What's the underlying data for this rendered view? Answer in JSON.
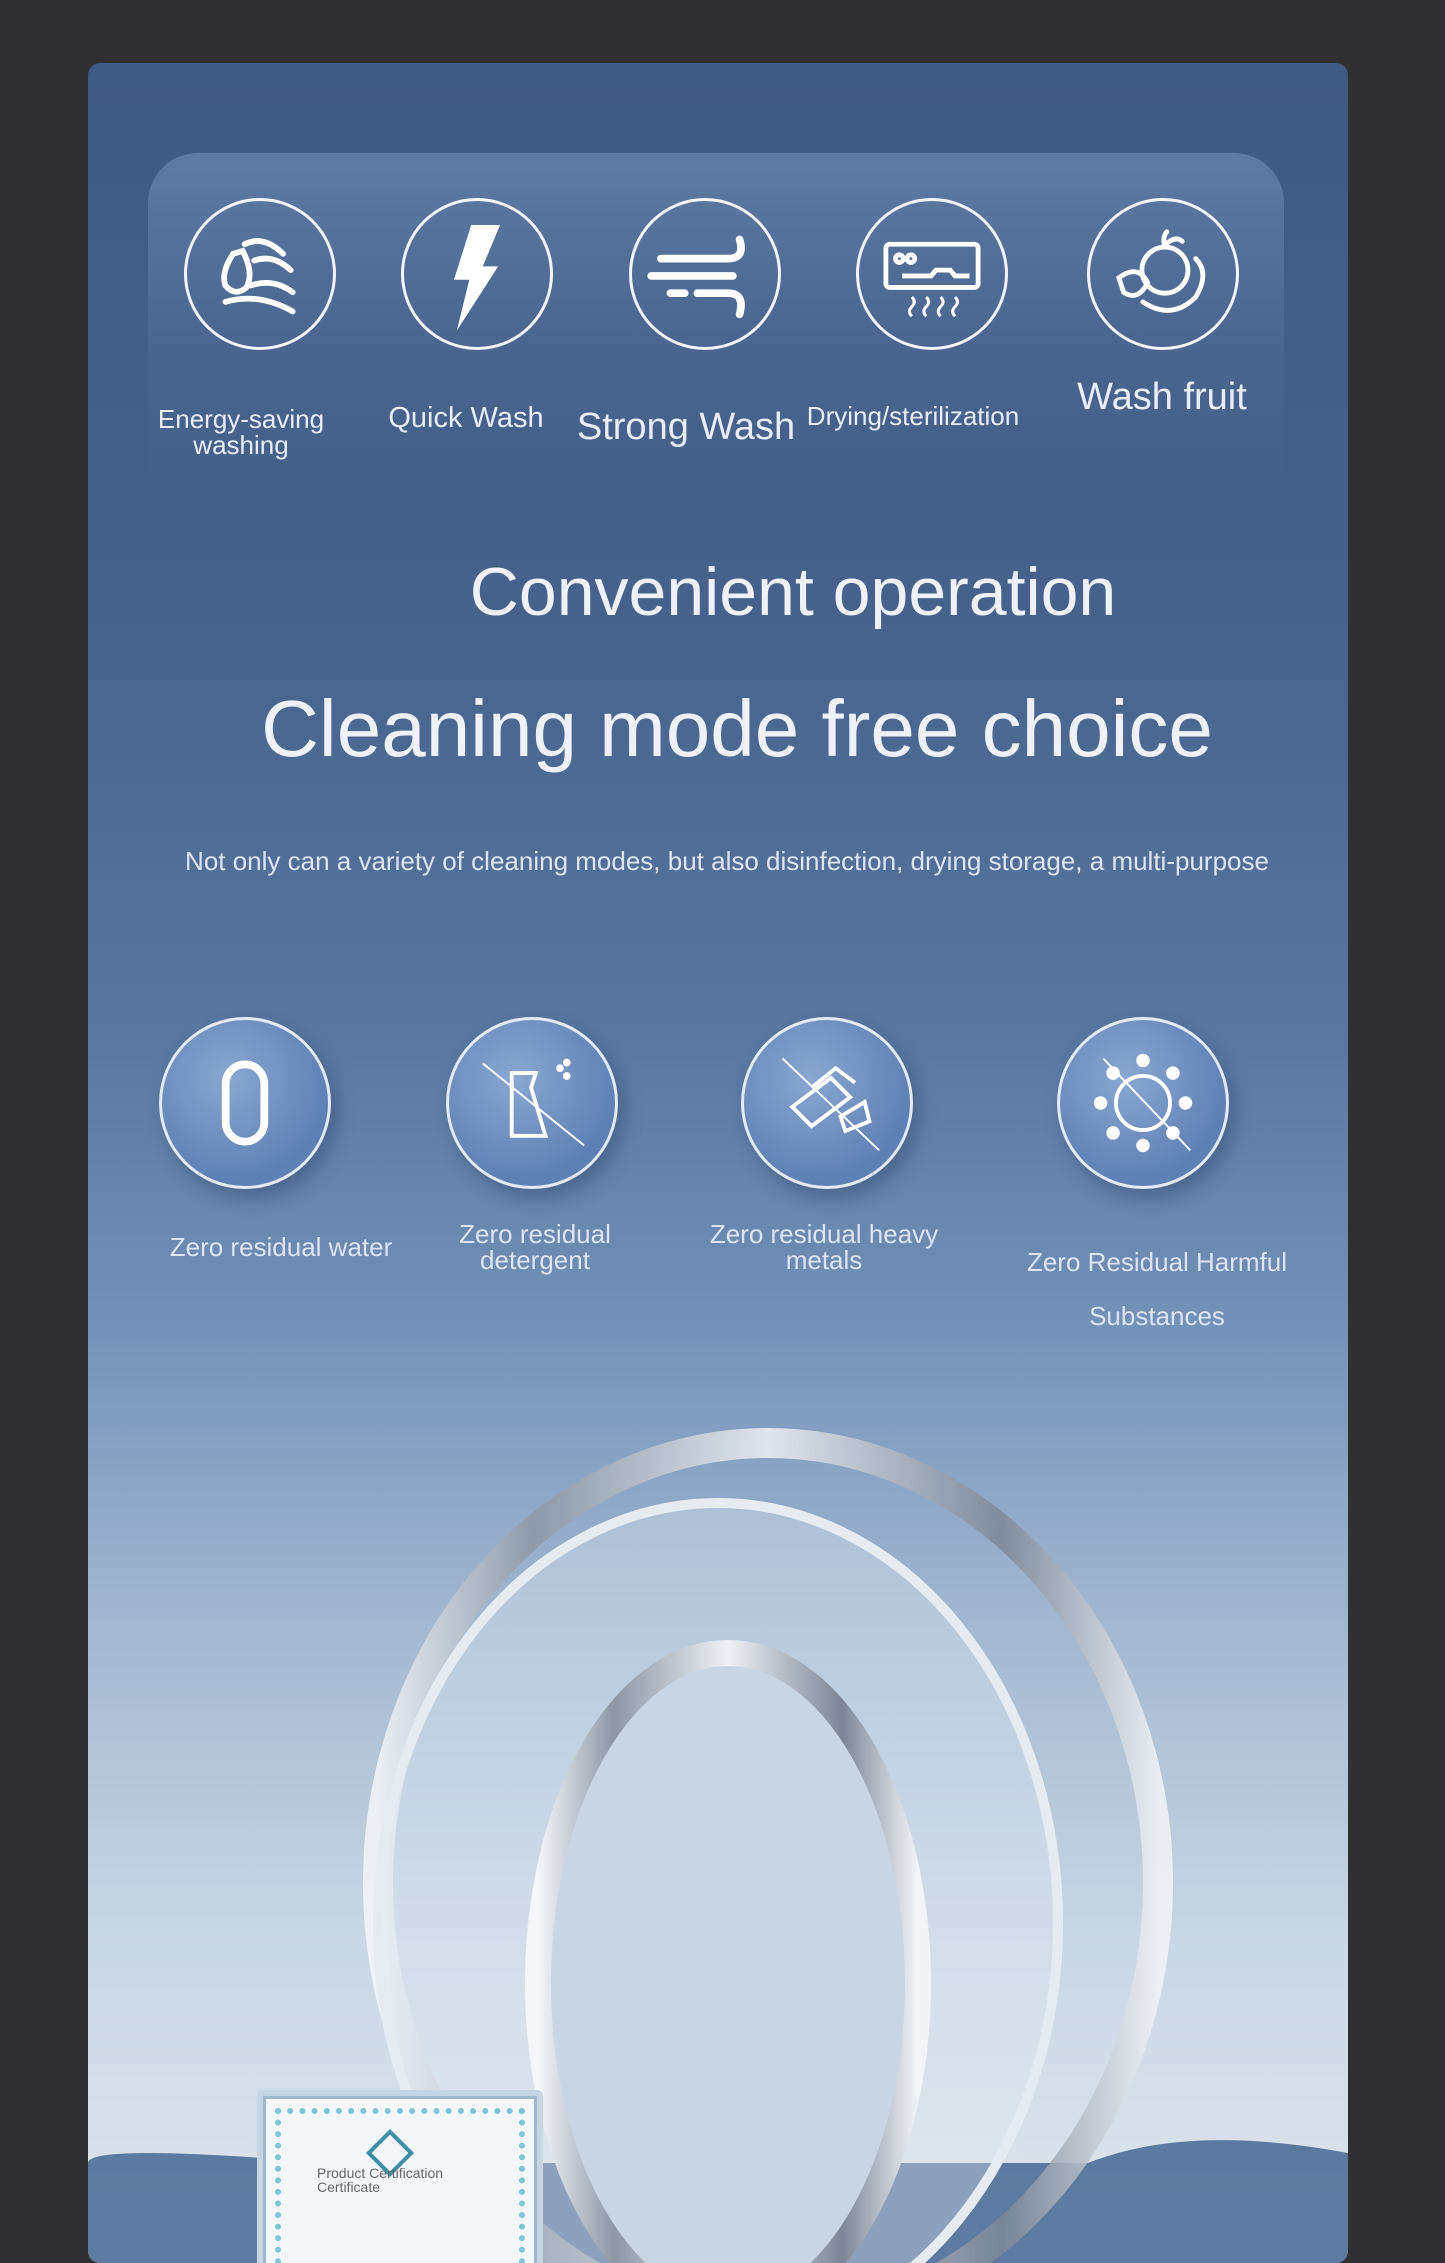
{
  "modes": [
    {
      "label_lines": [
        "Energy-saving",
        "washing"
      ],
      "icon": "water-drop-waves-icon"
    },
    {
      "label": "Quick Wash",
      "icon": "lightning-icon"
    },
    {
      "label": "Strong Wash",
      "icon": "wind-icon"
    },
    {
      "label": "Drying/sterilization",
      "icon": "air-dryer-icon"
    },
    {
      "label": "Wash fruit",
      "icon": "fruit-icon"
    }
  ],
  "headline": "Convenient operation",
  "title": "Cleaning mode free choice",
  "description": "Not only can a variety of cleaning modes, but also disinfection, drying storage, a multi-purpose",
  "features": [
    {
      "label_lines": [
        "Zero residual water"
      ],
      "icon": "zero-icon"
    },
    {
      "label_lines": [
        "Zero residual",
        "detergent"
      ],
      "icon": "no-spray-bottle-icon"
    },
    {
      "label_lines": [
        "Zero residual heavy",
        "metals"
      ],
      "icon": "no-metal-bars-icon"
    },
    {
      "label_lines": [
        "Zero Residual Harmful",
        "Substances"
      ],
      "icon": "no-bacteria-icon"
    }
  ],
  "certificate": {
    "label_lines": [
      "Product Certification",
      "Certificate"
    ]
  },
  "colors": {
    "page_bg": "#303032",
    "card_top": "#3f5a84",
    "card_bottom": "#dfe7ef"
  }
}
